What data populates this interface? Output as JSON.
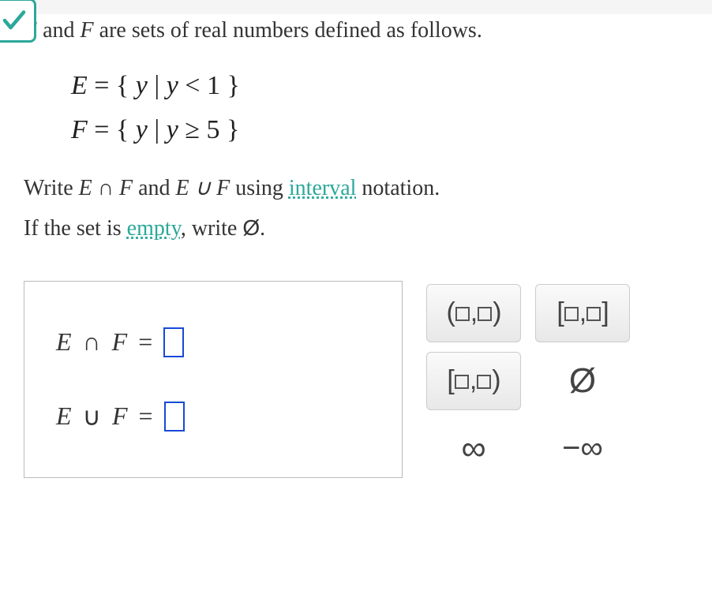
{
  "problem": {
    "intro_prefix": " and ",
    "intro_suffix": " are sets of real numbers defined as follows.",
    "set_E_var": "E",
    "set_F_var": "F",
    "set_E_def": "E = { y | y < 1 }",
    "set_F_def": "F = { y | y ≥ 5 }",
    "instruction_write": "Write ",
    "instruction_and": " and ",
    "instruction_using": " using ",
    "link_interval": "interval",
    "instruction_notation": " notation.",
    "instruction_empty_prefix": "If the set is ",
    "link_empty": "empty",
    "instruction_empty_suffix": ", write ",
    "emptyset_symbol": "Ø",
    "period": "."
  },
  "answers": {
    "row1_E": "E",
    "row1_op": "∩",
    "row1_F": "F",
    "row1_eq": "=",
    "row2_E": "E",
    "row2_op": "∪",
    "row2_F": "F",
    "row2_eq": "=",
    "value1": "",
    "value2": ""
  },
  "palette": {
    "open_open": "(□,□)",
    "closed_closed": "[□,□]",
    "closed_open": "[□,□)",
    "emptyset": "Ø",
    "infinity": "∞",
    "neg_infinity": "−∞"
  }
}
